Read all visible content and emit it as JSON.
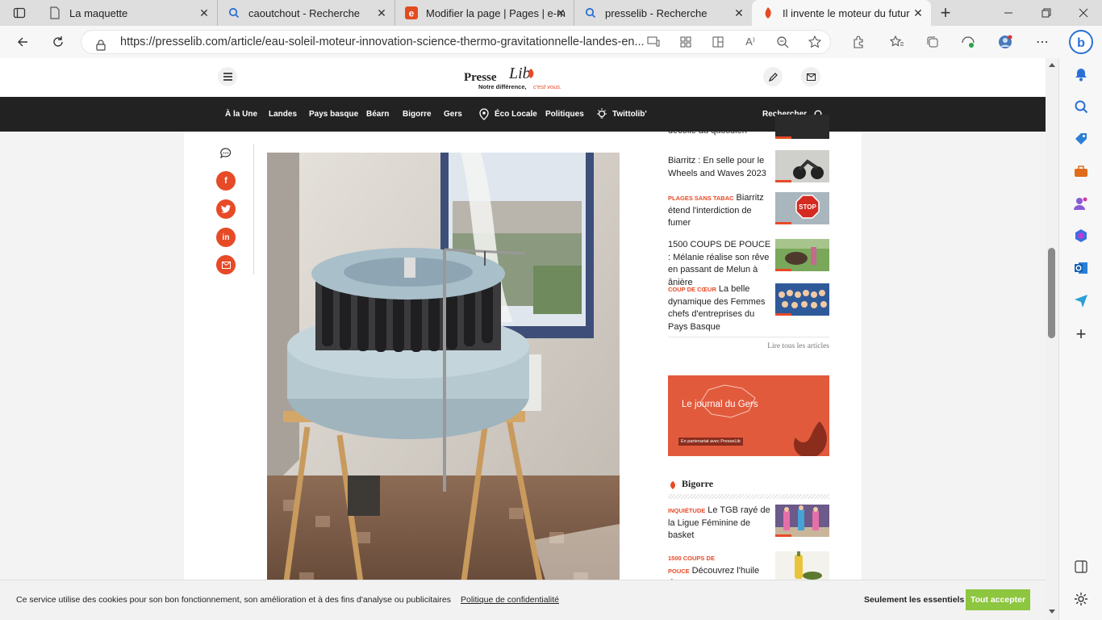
{
  "tabs": [
    {
      "title": "La maquette",
      "icon": "page-icon"
    },
    {
      "title": "caoutchout - Recherche",
      "icon": "search-icon"
    },
    {
      "title": "Modifier la page | Pages | e-m",
      "icon": "e-brand-icon"
    },
    {
      "title": "presselib - Recherche",
      "icon": "search-icon"
    },
    {
      "title": "Il invente le moteur du futur",
      "icon": "presselib-icon"
    }
  ],
  "address": {
    "url": "https://presselib.com/article/eau-soleil-moteur-innovation-science-thermo-gravitationnelle-landes-en..."
  },
  "site": {
    "logo_main": "Presse",
    "logo_script": "Lib",
    "tagline_a": "Notre différence,",
    "tagline_b": "c'est vous.",
    "nav": [
      "À la Une",
      "Landes",
      "Pays basque",
      "Béarn",
      "Bigorre",
      "Gers",
      "Éco Locale",
      "Politiques",
      "Twittolib'"
    ],
    "search_label": "Rechercher"
  },
  "sidebar_articles": [
    {
      "kicker": "",
      "title": "décolle au quotidien"
    },
    {
      "kicker": "",
      "title": "Biarritz : En selle pour le Wheels and Waves 2023"
    },
    {
      "kicker": "PLAGES SANS TABAC",
      "title": "Biarritz étend l'interdiction de fumer"
    },
    {
      "kicker": "",
      "title": "1500 COUPS DE POUCE : Mélanie réalise son rêve en passant de Melun à ânière"
    },
    {
      "kicker": "COUP DE CŒUR",
      "title": "La belle dynamique des Femmes chefs d'entreprises du Pays Basque"
    }
  ],
  "read_all": "Lire tous les articles",
  "banner": {
    "title": "Le journal du Gers",
    "subtitle": "En partenariat avec PresseLib",
    "color": "#e25a3c"
  },
  "bigorre": {
    "heading": "Bigorre",
    "articles": [
      {
        "kicker": "INQUIÉTUDE",
        "title": "Le TGB rayé de la Ligue Féminine de basket"
      },
      {
        "kicker": "1500 COUPS DE POUCE",
        "title": "Découvrez l'huile de"
      }
    ]
  },
  "cookie": {
    "text": "Ce service utilise des cookies pour son bon fonctionnement, son amélioration et à des fins d'analyse ou publicitaires",
    "policy": "Politique de confidentialité",
    "essentials": "Seulement les essentiels",
    "accept": "Tout accepter",
    "accept_color": "#8dc63f"
  },
  "colors": {
    "accent": "#e74a27",
    "nav_bg": "#222222"
  }
}
